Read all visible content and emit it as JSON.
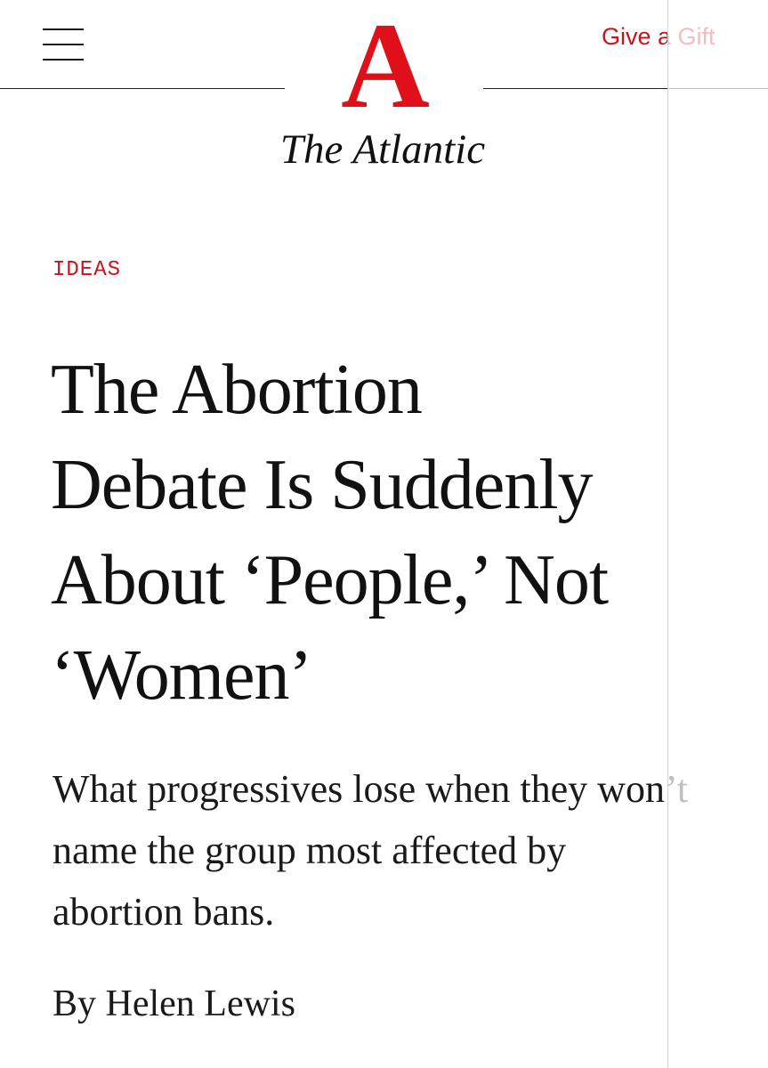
{
  "header": {
    "logo_letter": "A",
    "logo_wordmark": "The Atlantic",
    "gift_label": "Give a Gift",
    "menu_icon": "hamburger-menu-icon"
  },
  "article": {
    "section": "IDEAS",
    "headline_lines": [
      "The Abortion",
      "Debate Is Suddenly",
      "About ‘People,’ Not",
      "‘Women’"
    ],
    "dek_lines": [
      "What progressives lose when they won’t",
      "name the group most affected by",
      "abortion bans."
    ],
    "byline_prefix": "By",
    "author": "Helen Lewis"
  },
  "colors": {
    "brand_red": "#e0101b",
    "link_red": "#c8141e",
    "text": "#111111"
  }
}
